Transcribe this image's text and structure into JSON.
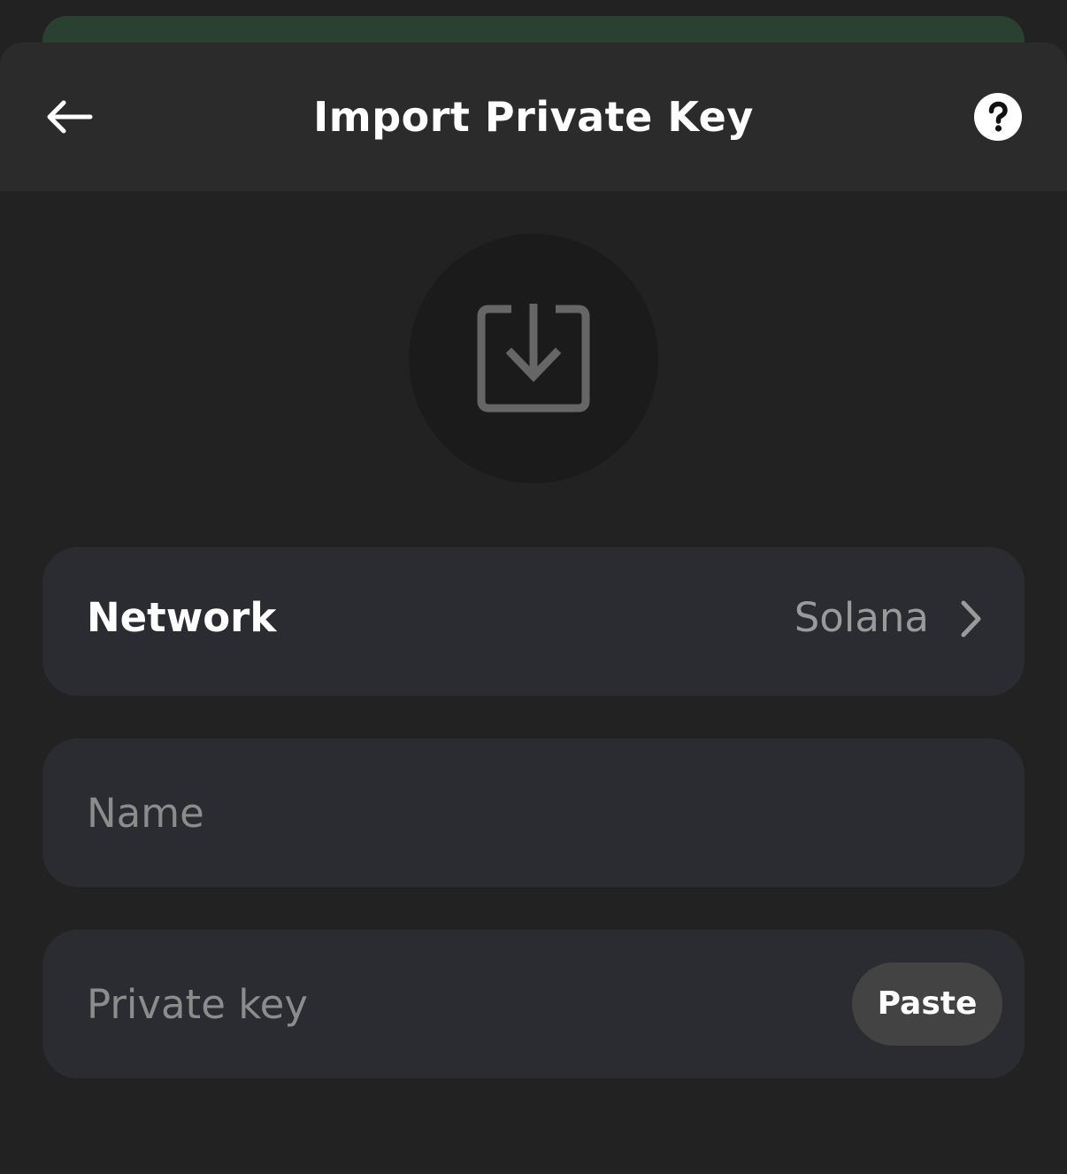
{
  "header": {
    "title": "Import Private Key",
    "back_icon": "arrow-left-icon",
    "help_icon": "question-circle-icon"
  },
  "hero": {
    "icon": "import-download-icon"
  },
  "form": {
    "network": {
      "label": "Network",
      "value": "Solana",
      "icon": "chevron-right-icon"
    },
    "name": {
      "placeholder": "Name",
      "value": ""
    },
    "private_key": {
      "placeholder": "Private key",
      "value": "",
      "paste_label": "Paste"
    }
  },
  "colors": {
    "background": "#222222",
    "header": "#2b2b2b",
    "field": "#2b2c31",
    "muted_text": "#9a9a9a",
    "paste_button": "#434343",
    "behind_card": "#2a4030"
  }
}
